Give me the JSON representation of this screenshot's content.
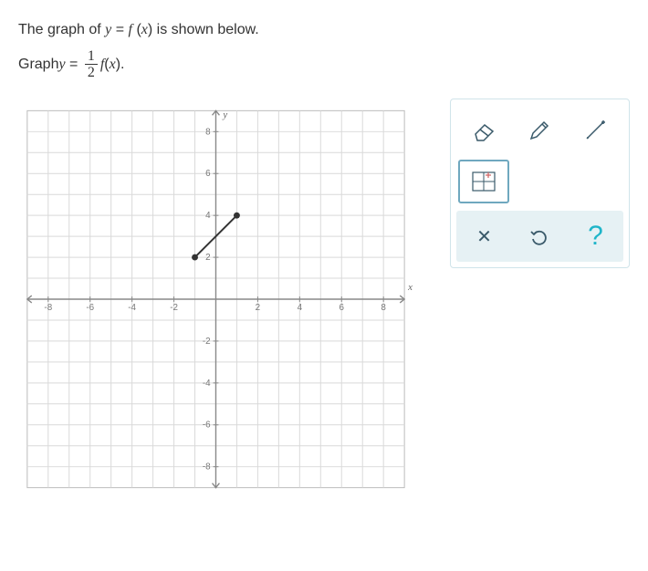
{
  "question": {
    "line1_pre": "The graph of ",
    "line1_eq_lhs": "y",
    "line1_eq_rhs": "f",
    "line1_var": "x",
    "line1_post": " is shown below.",
    "line2_pre": "Graph ",
    "line2_lhs": "y",
    "frac_num": "1",
    "frac_den": "2",
    "line2_f": "f",
    "line2_var": "x",
    "line2_post": "."
  },
  "chart_data": {
    "type": "line",
    "title": "",
    "xlabel": "x",
    "ylabel": "y",
    "xlim": [
      -9,
      9
    ],
    "ylim": [
      -9,
      9
    ],
    "xticks": [
      -8,
      -6,
      -4,
      -2,
      2,
      4,
      6,
      8
    ],
    "yticks": [
      -8,
      -6,
      -4,
      -2,
      2,
      4,
      6,
      8
    ],
    "series": [
      {
        "name": "f(x)",
        "points": [
          {
            "x": -1,
            "y": 2
          },
          {
            "x": 1,
            "y": 4
          }
        ]
      }
    ]
  },
  "tools": {
    "eraser": "eraser-icon",
    "pencil": "pencil-icon",
    "line": "line-tool-icon",
    "grid": "grid-tool-icon",
    "close": "✕",
    "undo": "↺",
    "help": "?"
  }
}
